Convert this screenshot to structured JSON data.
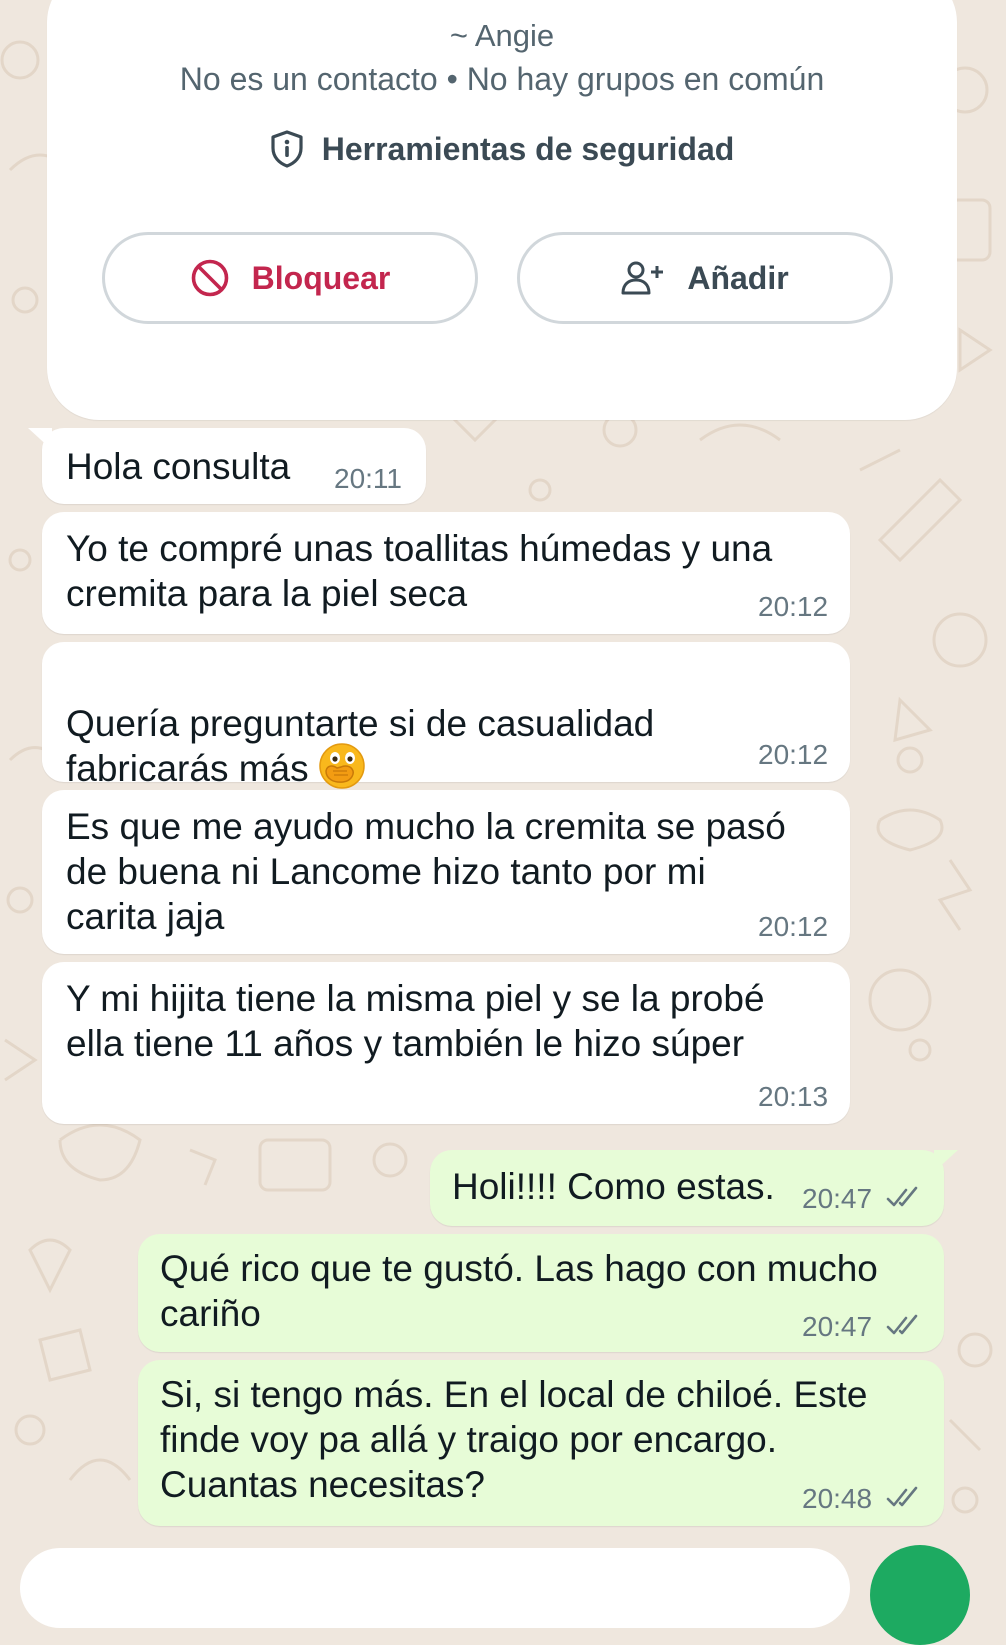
{
  "contact_card": {
    "name": "~ Angie",
    "subtitle": "No es un contacto • No hay grupos en común",
    "security_label": "Herramientas de seguridad",
    "block_label": "Bloquear",
    "add_label": "Añadir"
  },
  "messages": [
    {
      "direction": "in",
      "text": "Hola consulta",
      "time": "20:11"
    },
    {
      "direction": "in",
      "text": "Yo te compré unas toallitas húmedas y una\ncremita para la piel seca",
      "time": "20:12"
    },
    {
      "direction": "in",
      "text": "Quería preguntarte si de casualidad\nfabricarás más",
      "emoji": "face-with-hand-over-mouth",
      "time": "20:12"
    },
    {
      "direction": "in",
      "text": "Es que me ayudo mucho la cremita se pasó\nde buena ni Lancome hizo tanto por mi\ncarita jaja",
      "time": "20:12"
    },
    {
      "direction": "in",
      "text": "Y mi hijita tiene la misma piel y se la probé\nella tiene 11 años y también le hizo súper",
      "time": "20:13"
    },
    {
      "direction": "out",
      "text": "Holi!!!! Como estas.",
      "time": "20:47",
      "status": "read"
    },
    {
      "direction": "out",
      "text": "Qué rico que te gustó. Las hago con mucho\ncariño",
      "time": "20:47",
      "status": "read"
    },
    {
      "direction": "out",
      "text": "Si, si tengo más. En el local de chiloé. Este\nfinde voy pa allá y traigo por encargo.\nCuantas necesitas?",
      "time": "20:48",
      "status": "read"
    }
  ],
  "colors": {
    "background": "#efe7de",
    "incoming_bubble": "#ffffff",
    "outgoing_bubble": "#e7fcd7",
    "block_red": "#c3264e",
    "accent_green": "#1daa61"
  }
}
